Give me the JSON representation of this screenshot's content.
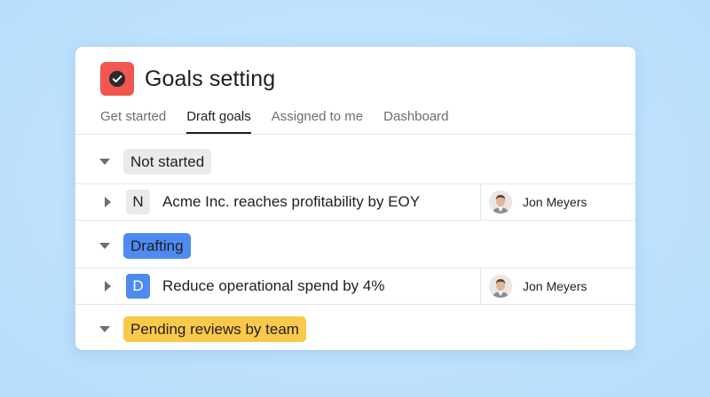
{
  "header": {
    "title": "Goals setting",
    "icon": "check-circle-icon",
    "icon_color": "#f0574f"
  },
  "tabs": [
    {
      "label": "Get started",
      "active": false
    },
    {
      "label": "Draft goals",
      "active": true
    },
    {
      "label": "Assigned to me",
      "active": false
    },
    {
      "label": "Dashboard",
      "active": false
    }
  ],
  "sections": [
    {
      "label": "Not started",
      "color": "#ebeaea",
      "goals": [
        {
          "letter": "N",
          "letter_bg": "#ebeaea",
          "letter_color": "#1e1f21",
          "name": "Acme Inc. reaches profitability by EOY",
          "assignee": "Jon Meyers"
        }
      ]
    },
    {
      "label": "Drafting",
      "color": "#4f8af0",
      "goals": [
        {
          "letter": "D",
          "letter_bg": "#4f8af0",
          "letter_color": "#ffffff",
          "name": "Reduce operational spend by 4%",
          "assignee": "Jon Meyers"
        }
      ]
    },
    {
      "label": "Pending reviews by team",
      "color": "#fbc94a",
      "goals": []
    }
  ]
}
